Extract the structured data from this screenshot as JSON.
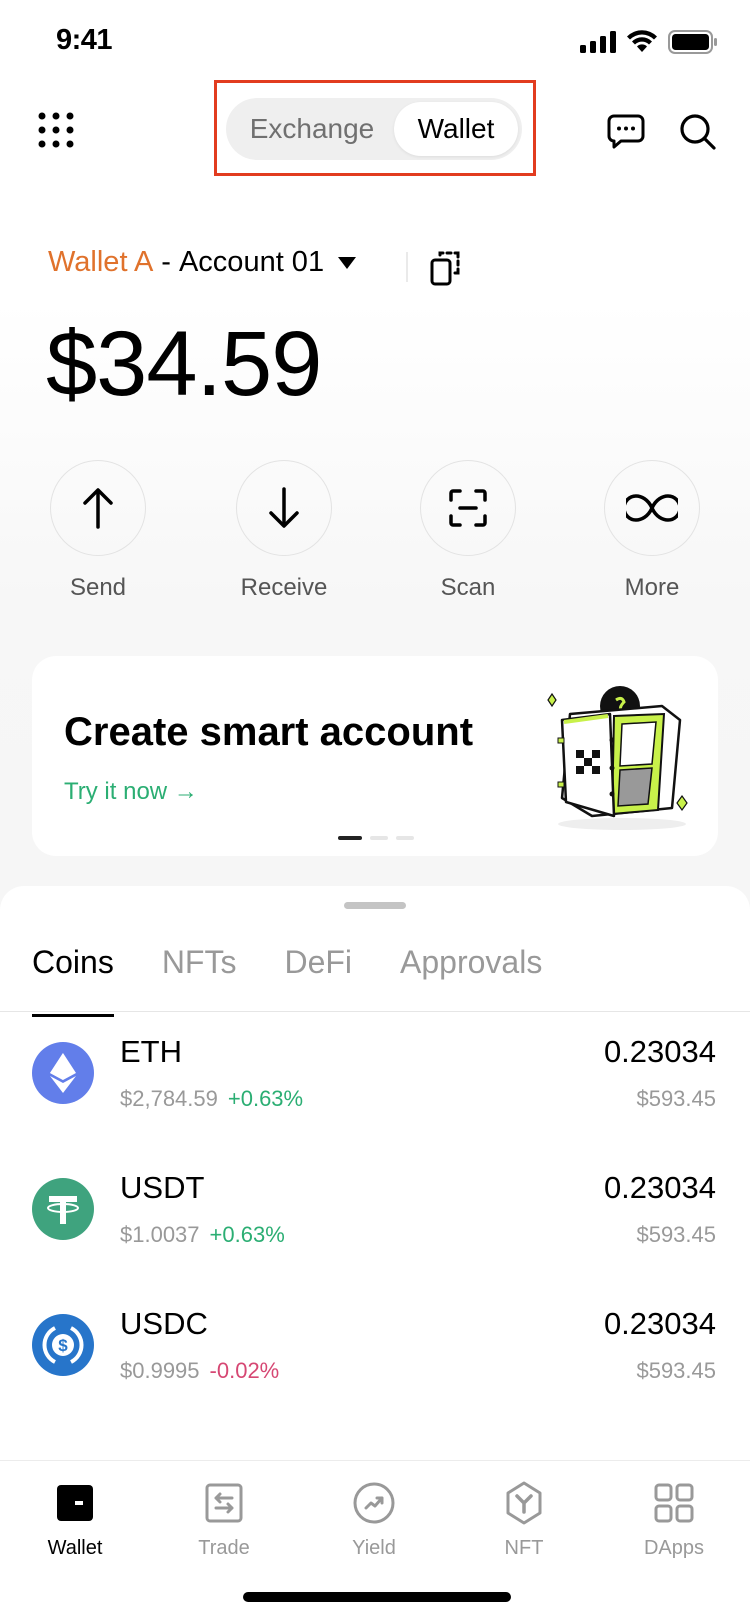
{
  "status_bar": {
    "time": "9:41"
  },
  "header": {
    "segment": {
      "options": [
        "Exchange",
        "Wallet"
      ],
      "selected": "Wallet"
    },
    "highlight_color": "#e23c1f"
  },
  "account": {
    "wallet_name": "Wallet A",
    "separator": "-",
    "account_name": "Account 01",
    "wallet_color": "#e0722c"
  },
  "balance": "$34.59",
  "actions": [
    {
      "label": "Send",
      "icon": "arrow-up-icon"
    },
    {
      "label": "Receive",
      "icon": "arrow-down-icon"
    },
    {
      "label": "Scan",
      "icon": "scan-icon"
    },
    {
      "label": "More",
      "icon": "infinity-icon"
    }
  ],
  "promo": {
    "title": "Create smart account",
    "link": "Try it now →",
    "carousel_index": 1,
    "carousel_count": 3
  },
  "tabs": {
    "items": [
      "Coins",
      "NFTs",
      "DeFi",
      "Approvals"
    ],
    "selected": "Coins"
  },
  "coins": [
    {
      "symbol": "ETH",
      "price": "$2,784.59",
      "change": "+0.63%",
      "direction": "up",
      "amount": "0.23034",
      "value": "$593.45",
      "color": "#627eea"
    },
    {
      "symbol": "USDT",
      "price": "$1.0037",
      "change": "+0.63%",
      "direction": "up",
      "amount": "0.23034",
      "value": "$593.45",
      "color": "#3fa37e"
    },
    {
      "symbol": "USDC",
      "price": "$0.9995",
      "change": "-0.02%",
      "direction": "down",
      "amount": "0.23034",
      "value": "$593.45",
      "color": "#2775ca"
    }
  ],
  "colors": {
    "up": "#2bae73",
    "down": "#d64773",
    "link": "#2bae73"
  },
  "bottom_nav": {
    "items": [
      "Wallet",
      "Trade",
      "Yield",
      "NFT",
      "DApps"
    ],
    "selected": "Wallet"
  }
}
